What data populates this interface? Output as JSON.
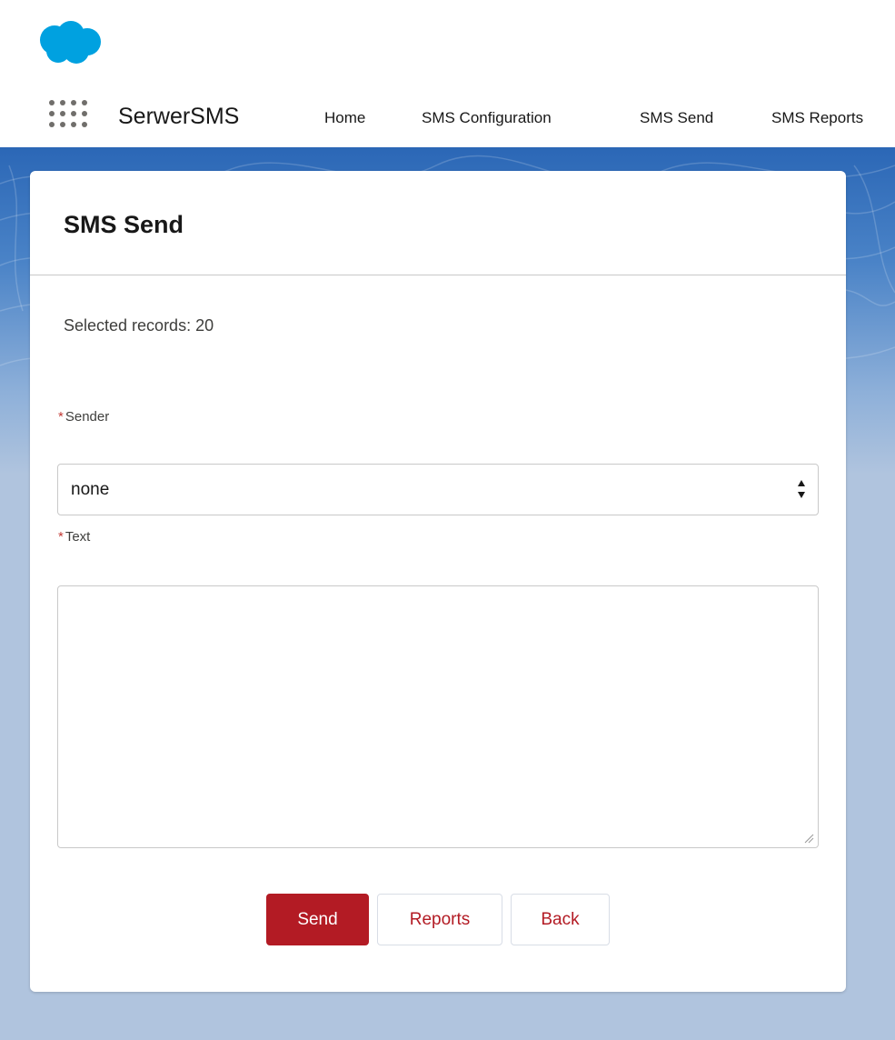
{
  "header": {
    "logo_icon": "cloud-logo-icon",
    "logo_color": "#00a1e0",
    "app_launcher_icon": "app-launcher-grid-icon",
    "app_name": "SerwerSMS",
    "nav": [
      {
        "label": "Home"
      },
      {
        "label": "SMS Configuration"
      },
      {
        "label": "SMS Send"
      },
      {
        "label": "SMS Reports"
      }
    ]
  },
  "card": {
    "title": "SMS Send",
    "selected_records": "Selected records: 20",
    "sender": {
      "required_mark": "*",
      "label": "Sender",
      "value": "none"
    },
    "text": {
      "required_mark": "*",
      "label": "Text",
      "value": ""
    },
    "buttons": {
      "send": "Send",
      "reports": "Reports",
      "back": "Back"
    }
  },
  "colors": {
    "brand_blue": "#2b67b6",
    "button_red": "#b31b24",
    "required_red": "#c23934"
  }
}
